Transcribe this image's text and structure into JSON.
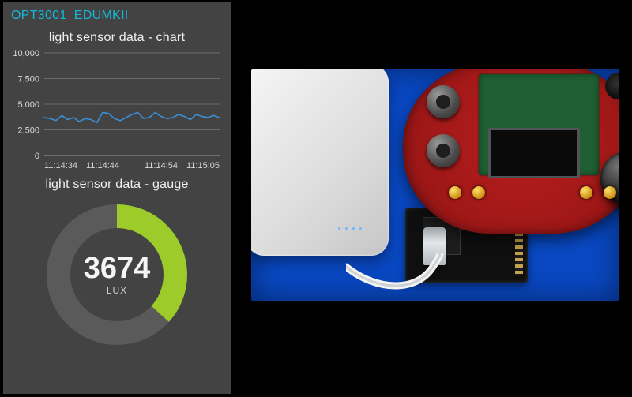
{
  "panel": {
    "title": "OPT3001_EDUMKII",
    "chart_title": "light sensor data - chart",
    "gauge_title": "light sensor data - gauge"
  },
  "gauge": {
    "value": 3674,
    "unit": "LUX",
    "min": 0,
    "max": 10000,
    "ring_bg": "#5a5a5a",
    "ring_fg": "#9ccb2a"
  },
  "hardware_scene": {
    "background_surface": "blue-mat",
    "items": [
      "power-bank",
      "usb-cable",
      "TI-EDU-MKII-boosterpack-red-board",
      "black-daughterboard",
      "joystick",
      "buzzer",
      "lcd-screen",
      "pushbutton",
      "status-leds"
    ]
  },
  "chart_data": {
    "type": "line",
    "title": "light sensor data - chart",
    "xlabel": "",
    "ylabel": "",
    "ylim": [
      0,
      10000
    ],
    "y_ticks": [
      0,
      2500,
      5000,
      7500,
      10000
    ],
    "x_ticks": [
      "11:14:34",
      "11:14:44",
      "11:14:54",
      "11:15:05"
    ],
    "series": [
      {
        "name": "lux",
        "color": "#3a8fd6",
        "values": [
          3700,
          3600,
          3400,
          3900,
          3500,
          3700,
          3300,
          3600,
          3500,
          3200,
          4200,
          4100,
          3600,
          3400,
          3700,
          4000,
          4200,
          3600,
          3700,
          4200,
          3800,
          3600,
          3700,
          4000,
          3800,
          3500,
          4000,
          3800,
          3700,
          3900,
          3674
        ]
      }
    ]
  }
}
